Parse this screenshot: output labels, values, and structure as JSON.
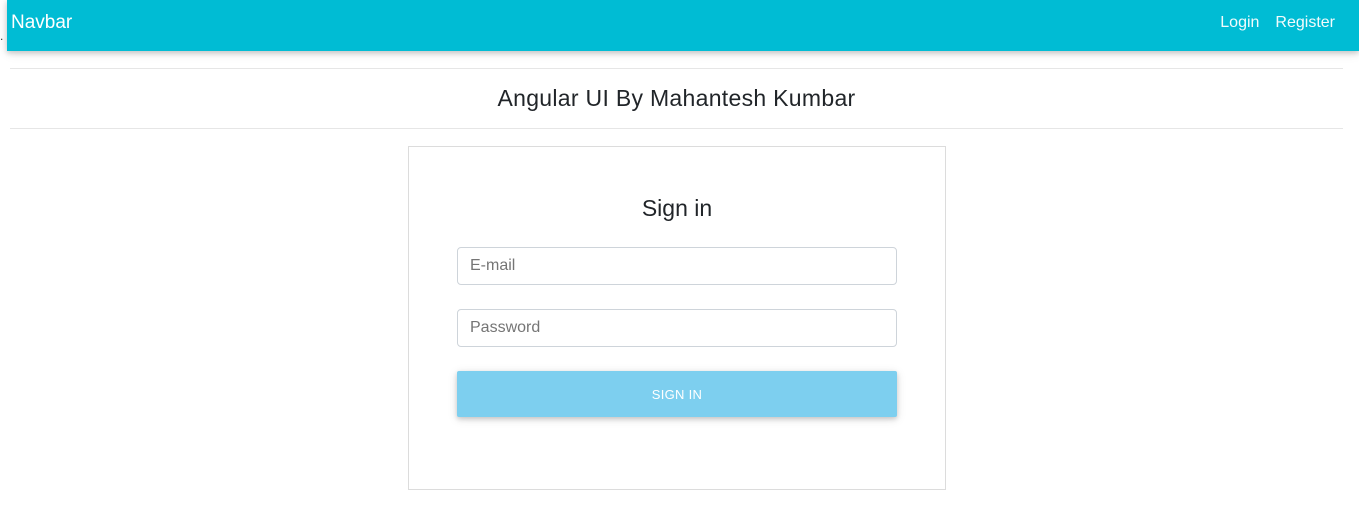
{
  "navbar": {
    "brand": "Navbar",
    "links": [
      {
        "label": "Login"
      },
      {
        "label": "Register"
      }
    ],
    "background_color": "#00bcd4"
  },
  "header": {
    "title": "Angular UI By Mahantesh Kumbar"
  },
  "signin_card": {
    "title": "Sign in",
    "email": {
      "placeholder": "E-mail",
      "value": ""
    },
    "password": {
      "placeholder": "Password",
      "value": ""
    },
    "submit_label": "SIGN IN",
    "button_color": "#7dcfef"
  },
  "stray_text": "."
}
